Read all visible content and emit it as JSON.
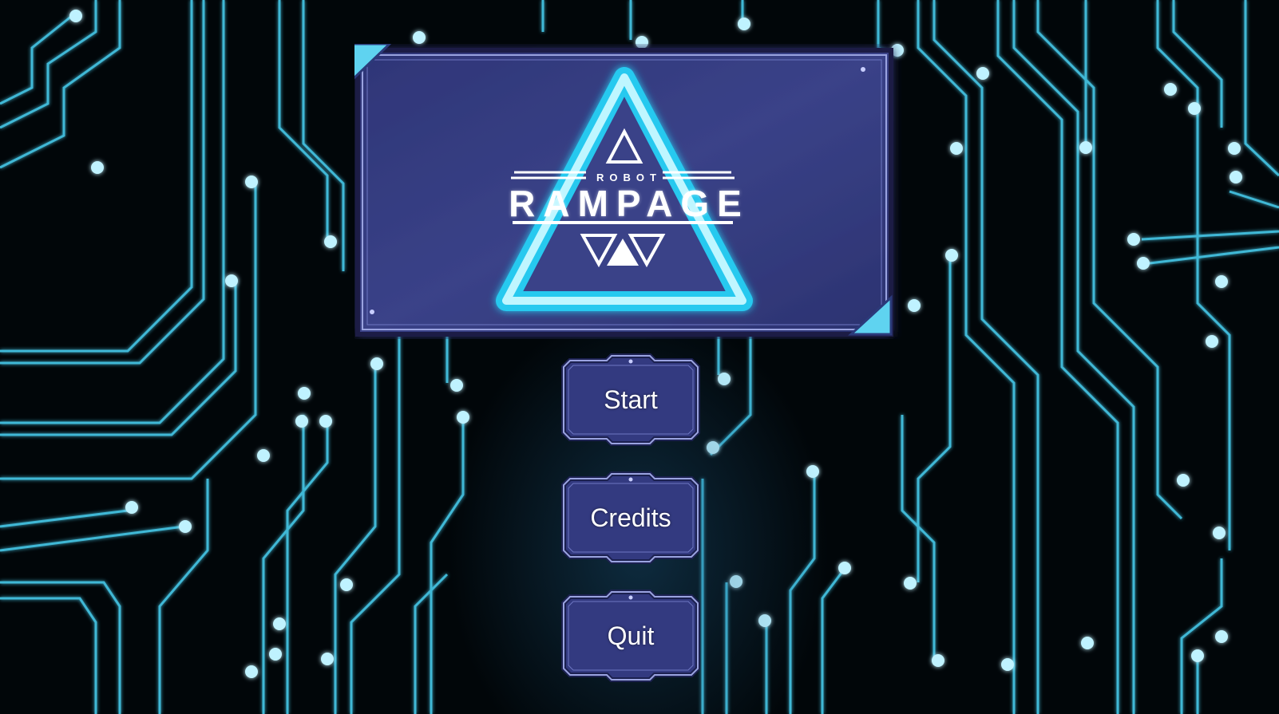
{
  "game": {
    "logo_subtitle": "ROBOT",
    "logo_title": "RAMPAGE"
  },
  "menu": {
    "start_label": "Start",
    "credits_label": "Credits",
    "quit_label": "Quit"
  },
  "colors": {
    "background": "#010609",
    "circuit_trace": "#3fb8d6",
    "panel_fill": "#323a7a",
    "panel_border": "#8a94d8",
    "neon_cyan": "#27c9ef"
  },
  "icons": [
    "circuit-board-background",
    "triangle-logo-icon"
  ]
}
